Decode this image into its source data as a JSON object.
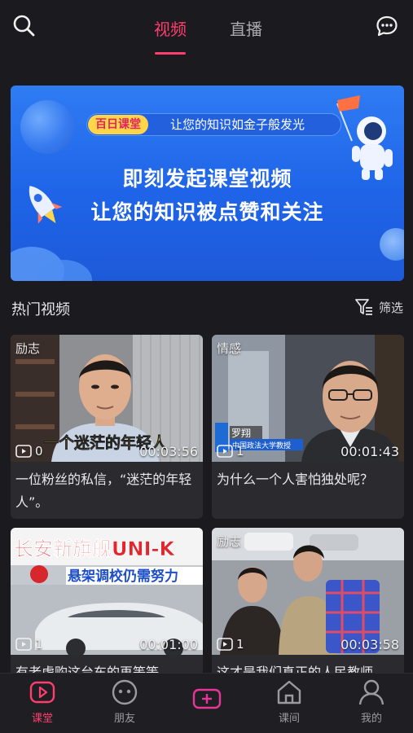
{
  "header": {
    "tabs": [
      {
        "label": "视频",
        "active": true
      },
      {
        "label": "直播",
        "active": false
      }
    ],
    "accent_color": "#ff3d6e"
  },
  "banner": {
    "tag": "百日课堂",
    "slogan": "让您的知识如金子般发光",
    "headline_1": "即刻发起课堂视频",
    "headline_2": "让您的知识被点赞和关注",
    "background_color": "#2270ec"
  },
  "section": {
    "title": "热门视频",
    "filter_label": "筛选"
  },
  "videos": [
    {
      "category": "励志",
      "views": "0",
      "duration": "00:03:56",
      "title": "一位粉丝的私信，“迷茫的年轻人”。",
      "overlay_caption": "一个迷茫的年轻人"
    },
    {
      "category": "情感",
      "views": "1",
      "duration": "00:01:43",
      "title": "为什么一个人害怕独处呢？",
      "overlay_name": "罗翔",
      "overlay_affiliation": "中国政法大学教授"
    },
    {
      "category": "",
      "views": "1",
      "duration": "00:01:00",
      "title": "有老虎购这台车的再等等",
      "overlay_headline": "长安新旗舰UNI-K",
      "overlay_subhead": "悬架调校仍需努力"
    },
    {
      "category": "励志",
      "views": "1",
      "duration": "00:03:58",
      "title": "这才是我们真正的人民教师"
    }
  ],
  "bottom_nav": [
    {
      "label": "课堂",
      "icon": "play-square-icon",
      "active": true
    },
    {
      "label": "朋友",
      "icon": "face-icon",
      "active": false
    },
    {
      "label": "",
      "icon": "plus-box-icon",
      "active": false
    },
    {
      "label": "课间",
      "icon": "home-icon",
      "active": false
    },
    {
      "label": "我的",
      "icon": "person-icon",
      "active": false
    }
  ]
}
